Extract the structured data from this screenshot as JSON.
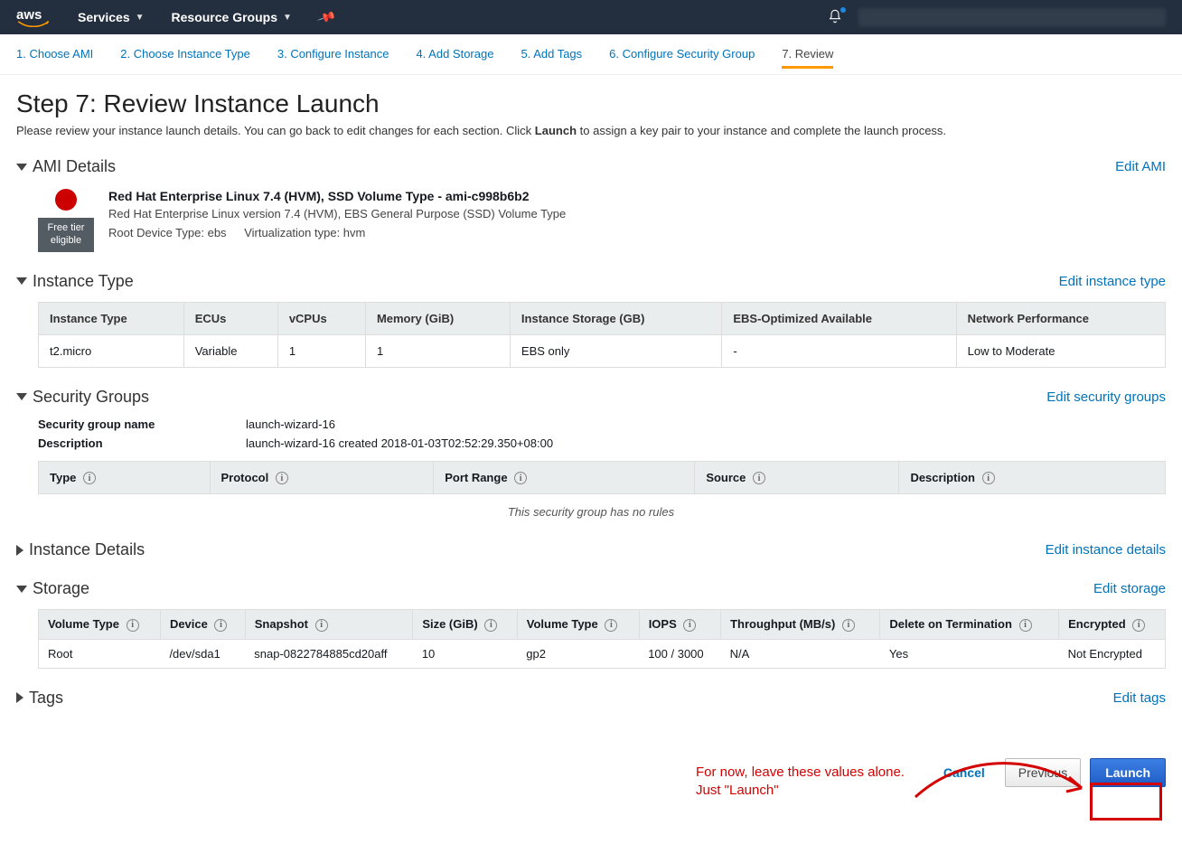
{
  "nav": {
    "services": "Services",
    "resource_groups": "Resource Groups"
  },
  "wizard": {
    "steps": [
      {
        "label": "1. Choose AMI"
      },
      {
        "label": "2. Choose Instance Type"
      },
      {
        "label": "3. Configure Instance"
      },
      {
        "label": "4. Add Storage"
      },
      {
        "label": "5. Add Tags"
      },
      {
        "label": "6. Configure Security Group"
      },
      {
        "label": "7. Review"
      }
    ]
  },
  "heading": {
    "title": "Step 7: Review Instance Launch",
    "sub_pre": "Please review your instance launch details. You can go back to edit changes for each section. Click ",
    "sub_b": "Launch",
    "sub_post": " to assign a key pair to your instance and complete the launch process."
  },
  "ami": {
    "section_title": "AMI Details",
    "edit": "Edit AMI",
    "free_tier1": "Free tier",
    "free_tier2": "eligible",
    "title": "Red Hat Enterprise Linux 7.4 (HVM), SSD Volume Type - ami-c998b6b2",
    "desc": "Red Hat Enterprise Linux version 7.4 (HVM), EBS General Purpose (SSD) Volume Type",
    "rootdev": "Root Device Type: ebs",
    "virt": "Virtualization type: hvm"
  },
  "instancetype": {
    "section_title": "Instance Type",
    "edit": "Edit instance type",
    "headers": [
      "Instance Type",
      "ECUs",
      "vCPUs",
      "Memory (GiB)",
      "Instance Storage (GB)",
      "EBS-Optimized Available",
      "Network Performance"
    ],
    "row": {
      "type": "t2.micro",
      "ecus": "Variable",
      "vcpus": "1",
      "mem": "1",
      "storage": "EBS only",
      "ebsopt": "-",
      "net": "Low to Moderate"
    }
  },
  "sg": {
    "section_title": "Security Groups",
    "edit": "Edit security groups",
    "name_label": "Security group name",
    "name": "launch-wizard-16",
    "desc_label": "Description",
    "desc": "launch-wizard-16 created 2018-01-03T02:52:29.350+08:00",
    "headers": [
      "Type",
      "Protocol",
      "Port Range",
      "Source",
      "Description"
    ],
    "empty": "This security group has no rules"
  },
  "instance_details": {
    "section_title": "Instance Details",
    "edit": "Edit instance details"
  },
  "storage": {
    "section_title": "Storage",
    "edit": "Edit storage",
    "headers": [
      "Volume Type",
      "Device",
      "Snapshot",
      "Size (GiB)",
      "Volume Type",
      "IOPS",
      "Throughput (MB/s)",
      "Delete on Termination",
      "Encrypted"
    ],
    "row": {
      "vt": "Root",
      "dev": "/dev/sda1",
      "snap": "snap-0822784885cd20aff",
      "size": "10",
      "vtype": "gp2",
      "iops": "100 / 3000",
      "thr": "N/A",
      "del": "Yes",
      "enc": "Not Encrypted"
    }
  },
  "tags": {
    "section_title": "Tags",
    "edit": "Edit tags"
  },
  "buttons": {
    "cancel": "Cancel",
    "previous": "Previous",
    "launch": "Launch"
  },
  "annotation": {
    "line1": "For now, leave these values alone.",
    "line2": "Just \"Launch\""
  }
}
